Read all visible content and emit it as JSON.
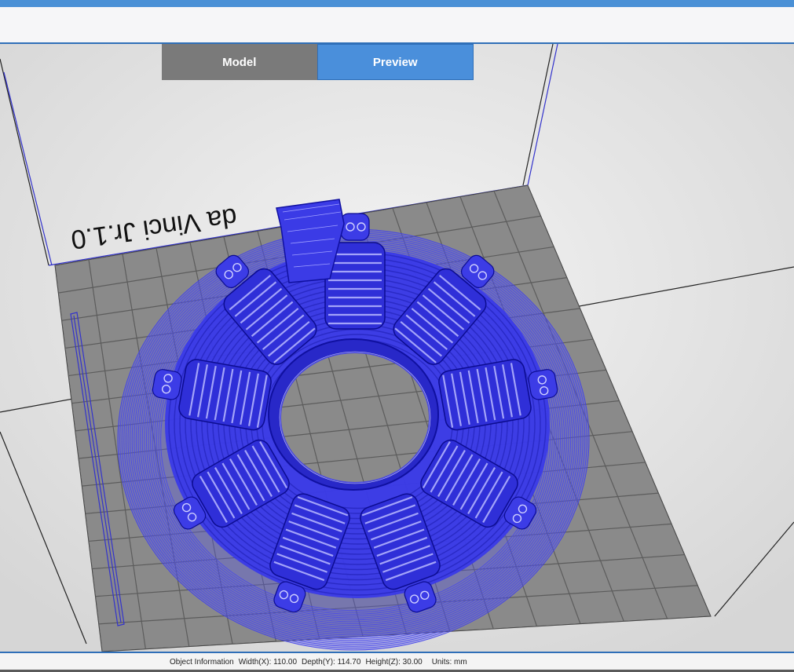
{
  "tabs": {
    "model_label": "Model",
    "preview_label": "Preview"
  },
  "printer": {
    "bed_label": "da Vinci Jr.1.0"
  },
  "object_info": {
    "label": "Object Information",
    "width": "Width(X): 110.00",
    "depth": "Depth(Y): 114.70",
    "height": "Height(Z): 30.00",
    "units": "Units: mm"
  },
  "colors": {
    "accent": "#4a90d6",
    "tab_active": "#4a8fdb",
    "tab_inactive": "#7a7a7a",
    "bed": "#8a8a8a",
    "toolpath": "#3030e6"
  }
}
